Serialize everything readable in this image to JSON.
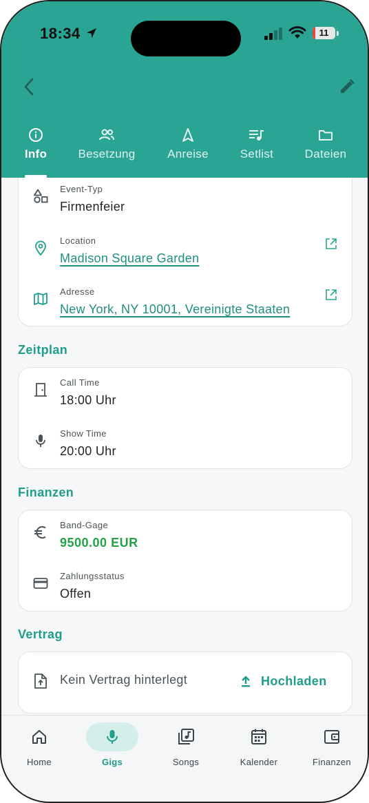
{
  "status_bar": {
    "time": "18:34",
    "battery": "11",
    "battery_level": 0.11
  },
  "colors": {
    "primary": "#2aa594",
    "accent_text": "#1f9d8b",
    "money": "#24a047",
    "battery_low": "#e0483d"
  },
  "header": {
    "back_icon": "chevron-left-icon",
    "edit_icon": "pencil-icon"
  },
  "tabs": [
    {
      "label": "Info",
      "icon": "info-icon",
      "active": true
    },
    {
      "label": "Besetzung",
      "icon": "people-icon",
      "active": false
    },
    {
      "label": "Anreise",
      "icon": "navigation-icon",
      "active": false
    },
    {
      "label": "Setlist",
      "icon": "playlist-icon",
      "active": false
    },
    {
      "label": "Dateien",
      "icon": "folder-icon",
      "active": false
    }
  ],
  "details": {
    "event_type": {
      "label": "Event-Typ",
      "value": "Firmenfeier",
      "icon": "shapes-icon"
    },
    "location": {
      "label": "Location",
      "value": "Madison Square Garden",
      "icon": "map-pin-icon"
    },
    "address": {
      "label": "Adresse",
      "value": "New York, NY 10001, Vereinigte Staaten",
      "icon": "map-icon"
    }
  },
  "schedule": {
    "title": "Zeitplan",
    "call_time": {
      "label": "Call Time",
      "value": "18:00 Uhr",
      "icon": "door-icon"
    },
    "show_time": {
      "label": "Show Time",
      "value": "20:00 Uhr",
      "icon": "microphone-icon"
    }
  },
  "finances": {
    "title": "Finanzen",
    "fee": {
      "label": "Band-Gage",
      "value": "9500.00 EUR",
      "icon": "euro-icon"
    },
    "payment_status": {
      "label": "Zahlungsstatus",
      "value": "Offen",
      "icon": "credit-card-icon"
    }
  },
  "contract": {
    "title": "Vertrag",
    "empty_text": "Kein Vertrag hinterlegt",
    "upload_label": "Hochladen"
  },
  "bottom_nav": [
    {
      "label": "Home",
      "icon": "home-icon",
      "active": false
    },
    {
      "label": "Gigs",
      "icon": "microphone-icon",
      "active": true
    },
    {
      "label": "Songs",
      "icon": "music-library-icon",
      "active": false
    },
    {
      "label": "Kalender",
      "icon": "calendar-icon",
      "active": false
    },
    {
      "label": "Finanzen",
      "icon": "wallet-icon",
      "active": false
    }
  ]
}
